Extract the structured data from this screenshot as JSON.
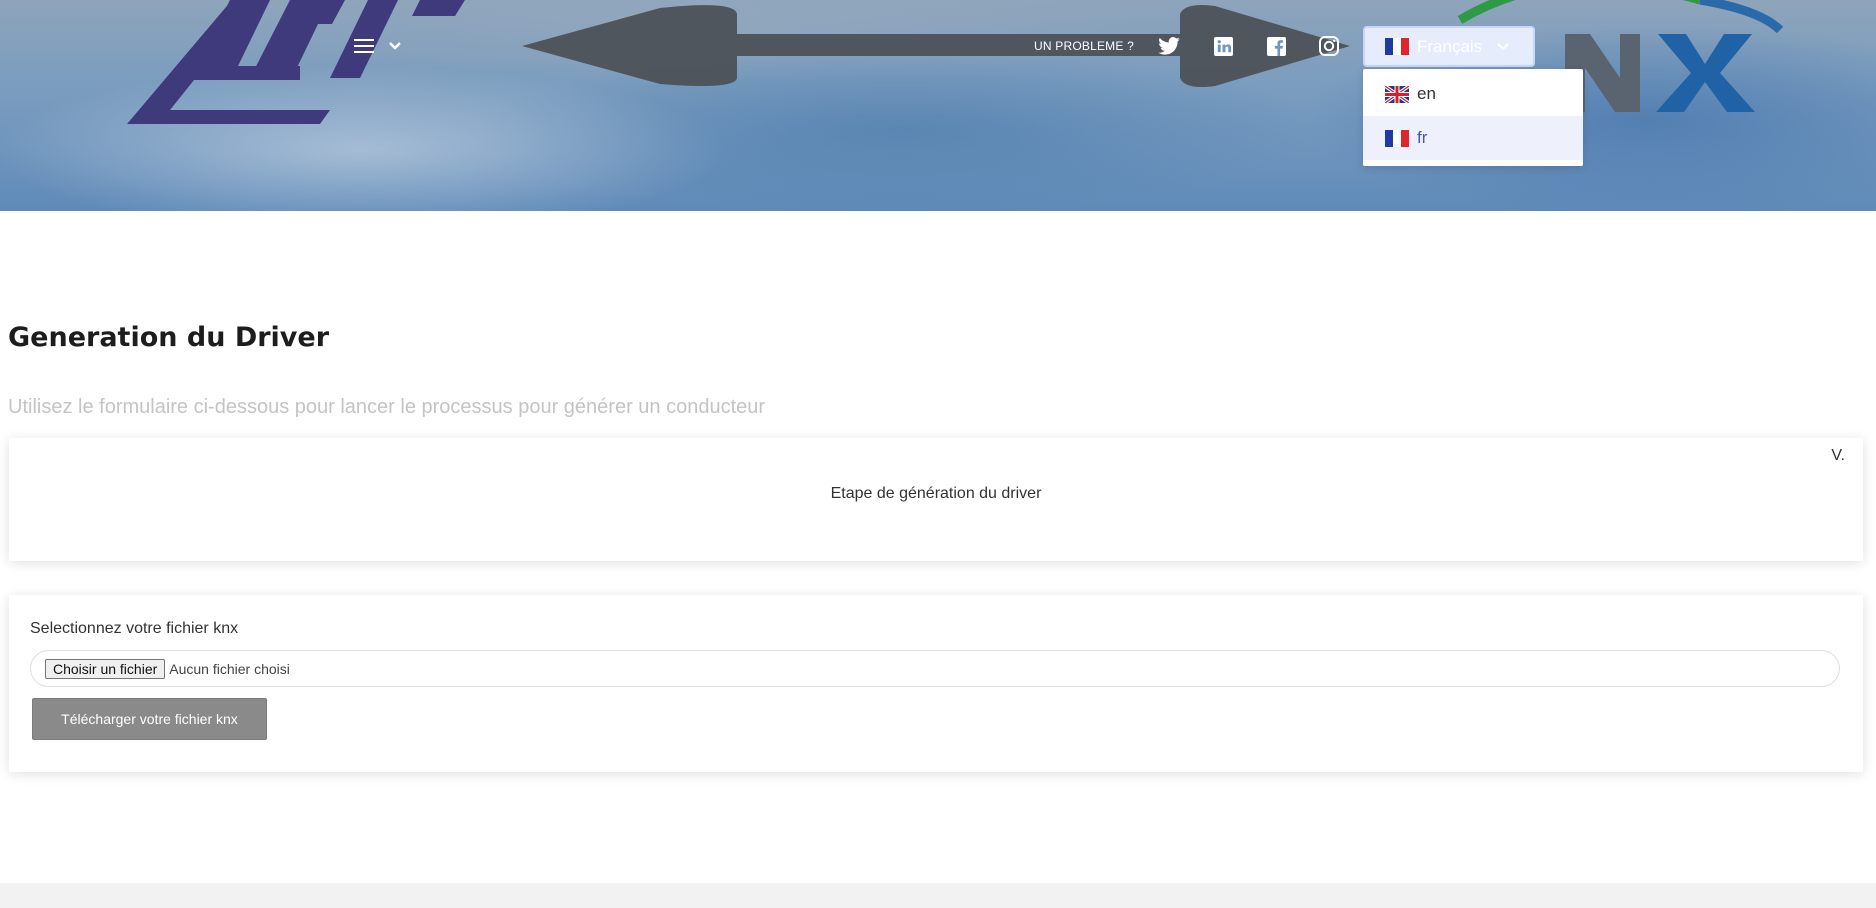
{
  "header": {
    "problem_link": "UN PROBLEME ?",
    "social_icons": [
      "twitter-icon",
      "linkedin-icon",
      "facebook-icon",
      "instagram-icon"
    ],
    "language_selector": {
      "current_label": "Français",
      "options": [
        {
          "code": "en",
          "flag": "uk-flag-icon"
        },
        {
          "code": "fr",
          "flag": "france-flag-icon",
          "selected": true
        }
      ]
    },
    "logos": {
      "left": "RTI",
      "right": "KNX"
    }
  },
  "main": {
    "title": "Generation du Driver",
    "subtitle": "Utilisez le formulaire ci-dessous pour lancer le processus pour générer un conducteur",
    "steps_card": {
      "version": "V.",
      "step_label": "Etape de génération du driver"
    },
    "upload_card": {
      "file_label": "Selectionnez votre fichier knx",
      "choose_button": "Choisir un fichier",
      "no_file": "Aucun fichier choisi",
      "upload_button": "Télécharger votre fichier knx"
    }
  },
  "colors": {
    "title": "#1d1d1d",
    "subtitle": "#c4c4c4",
    "upload_button": "#8a8a8a",
    "selected_option_bg": "#eef1fb",
    "rti_logo": "#3e3a7c",
    "knx_logo": "#2a6aa8"
  }
}
